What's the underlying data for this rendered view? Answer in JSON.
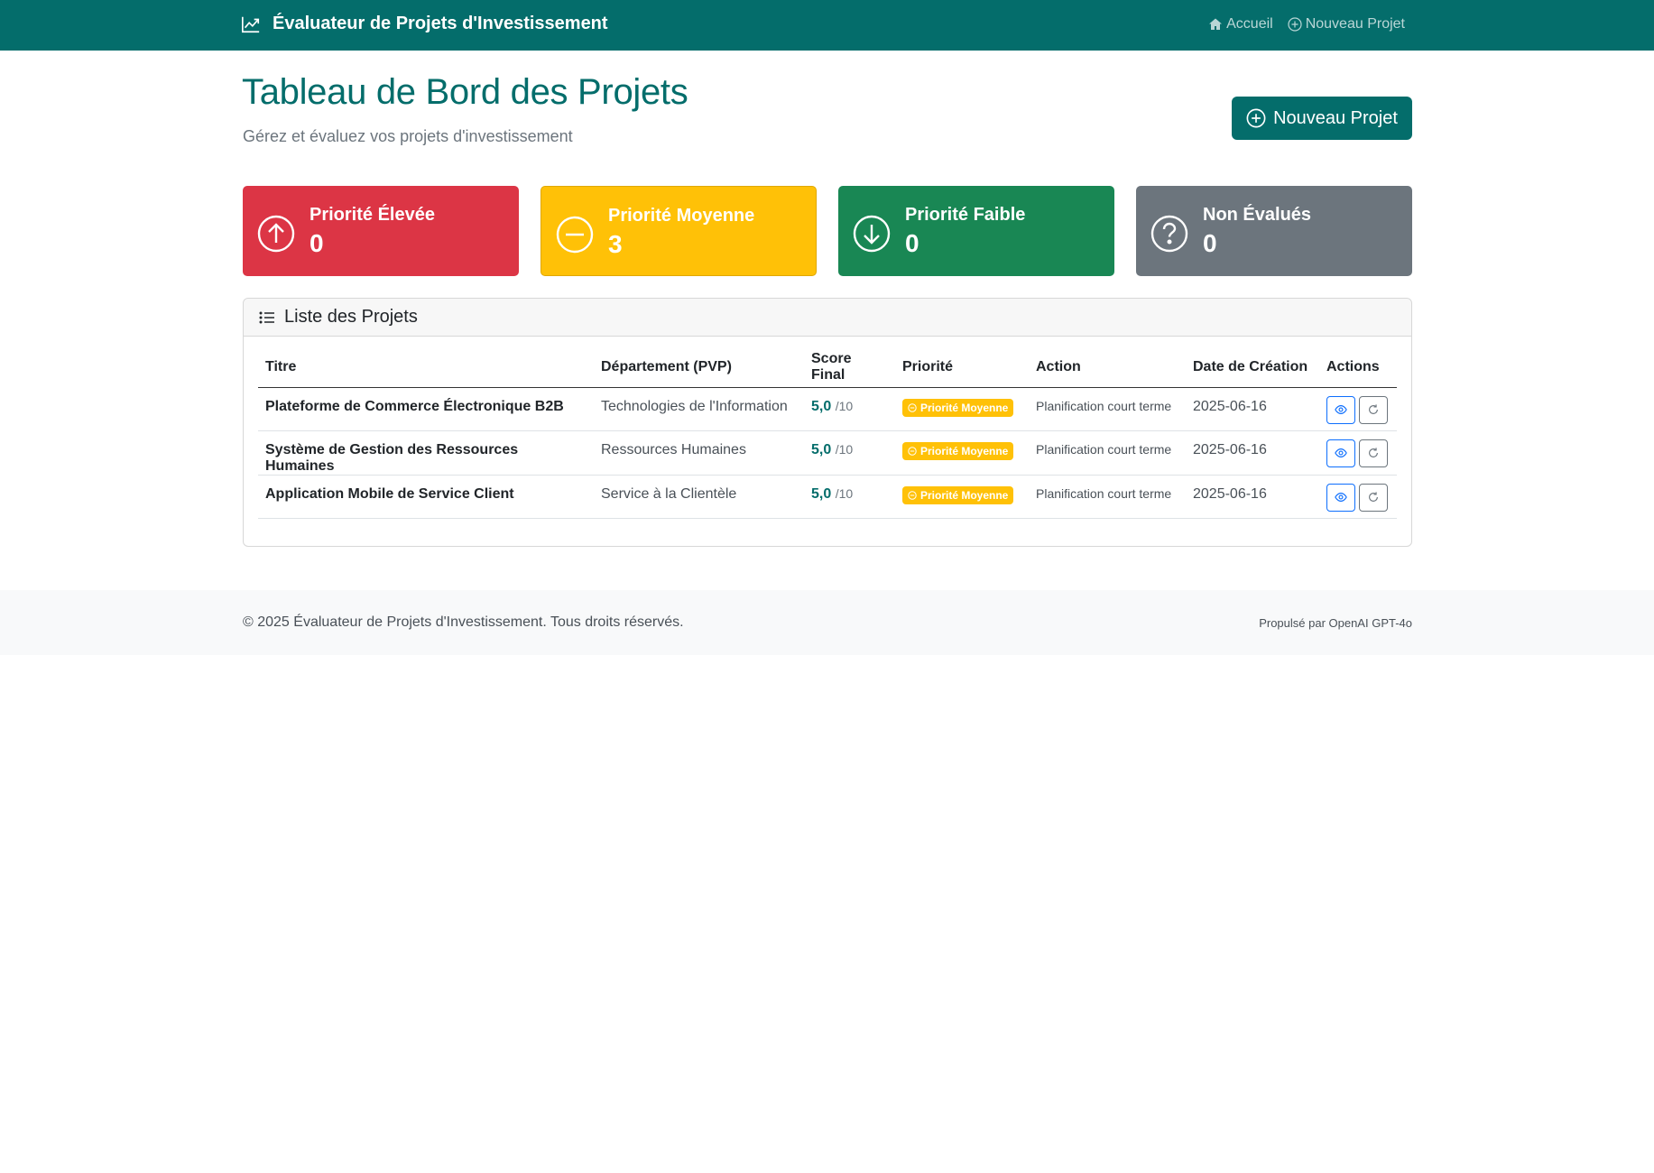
{
  "navbar": {
    "brand": "Évaluateur de Projets d'Investissement",
    "links": [
      {
        "label": "Accueil",
        "icon": "house-icon"
      },
      {
        "label": "Nouveau Projet",
        "icon": "plus-circle-icon"
      }
    ]
  },
  "header": {
    "title": "Tableau de Bord des Projets",
    "subtitle": "Gérez et évaluez vos projets d'investissement",
    "new_button": "Nouveau Projet"
  },
  "stats": [
    {
      "label": "Priorité Élevée",
      "value": "0",
      "color": "#dc3545",
      "icon": "arrow-up-circle-icon"
    },
    {
      "label": "Priorité Moyenne",
      "value": "3",
      "color": "#ffc107",
      "icon": "dash-circle-icon"
    },
    {
      "label": "Priorité Faible",
      "value": "0",
      "color": "#198754",
      "icon": "arrow-down-circle-icon"
    },
    {
      "label": "Non Évalués",
      "value": "0",
      "color": "#6c757d",
      "icon": "question-circle-icon"
    }
  ],
  "list": {
    "title": "Liste des Projets",
    "columns": [
      "Titre",
      "Département (PVP)",
      "Score Final",
      "Priorité",
      "Action",
      "Date de Création",
      "Actions"
    ],
    "rows": [
      {
        "title": "Plateforme de Commerce Électronique B2B",
        "department": "Technologies de l'Information",
        "score": "5,0",
        "score_max": "/10",
        "priority": "Priorité Moyenne",
        "action": "Planification court terme",
        "date": "2025-06-16"
      },
      {
        "title": "Système de Gestion des Ressources Humaines",
        "department": "Ressources Humaines",
        "score": "5,0",
        "score_max": "/10",
        "priority": "Priorité Moyenne",
        "action": "Planification court terme",
        "date": "2025-06-16"
      },
      {
        "title": "Application Mobile de Service Client",
        "department": "Service à la Clientèle",
        "score": "5,0",
        "score_max": "/10",
        "priority": "Priorité Moyenne",
        "action": "Planification court terme",
        "date": "2025-06-16"
      }
    ]
  },
  "footer": {
    "copyright": "© 2025 Évaluateur de Projets d'Investissement. Tous droits réservés.",
    "powered": "Propulsé par OpenAI GPT-4o"
  },
  "colors": {
    "brand": "#046d6b",
    "high": "#dc3545",
    "medium": "#ffc107",
    "low": "#198754",
    "unrated": "#6c757d"
  }
}
